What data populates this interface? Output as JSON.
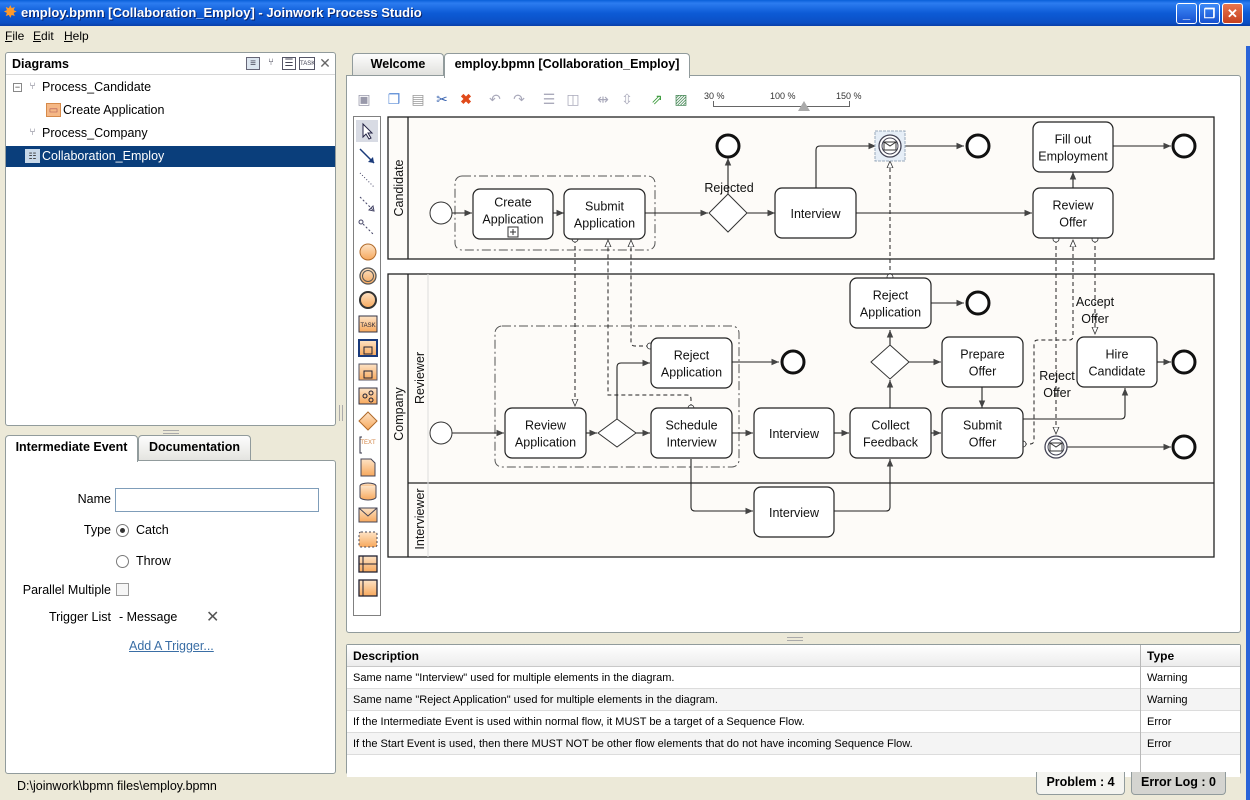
{
  "window": {
    "title": "employ.bpmn [Collaboration_Employ] - Joinwork Process Studio",
    "app_icon": "star-icon",
    "controls": [
      "minimize",
      "restore",
      "close"
    ]
  },
  "menu": [
    "File",
    "Edit",
    "Help"
  ],
  "diagrams_panel": {
    "title": "Diagrams",
    "header_icons": [
      "properties-icon",
      "process-icon",
      "collaboration-icon",
      "task-icon",
      "close-icon"
    ],
    "tree": [
      {
        "label": "Process_Candidate",
        "icon": "process-icon",
        "expanded": true,
        "level": 0
      },
      {
        "label": "Create Application",
        "icon": "subprocess-icon",
        "level": 1
      },
      {
        "label": "Process_Company",
        "icon": "process-warning-icon",
        "level": 0
      },
      {
        "label": "Collaboration_Employ",
        "icon": "collaboration-warning-icon",
        "level": 0,
        "selected": true
      }
    ]
  },
  "properties_panel": {
    "tabs": [
      "Intermediate Event",
      "Documentation"
    ],
    "active_tab": "Intermediate Event",
    "name_label": "Name",
    "name_value": "",
    "type_label": "Type",
    "type_options": [
      "Catch",
      "Throw"
    ],
    "type_selected": "Catch",
    "parallel_label": "Parallel Multiple",
    "parallel_checked": false,
    "trigger_label": "Trigger List",
    "trigger_value": "- Message",
    "add_trigger": "Add A Trigger..."
  },
  "editor": {
    "tabs": [
      "Welcome",
      "employ.bpmn [Collaboration_Employ]"
    ],
    "active_tab": "employ.bpmn [Collaboration_Employ]",
    "toolbar": [
      "save",
      "copy",
      "paste",
      "cut",
      "delete",
      "undo",
      "redo",
      "align-top",
      "align-middle",
      "distribute-h",
      "distribute-v",
      "export",
      "export-image"
    ],
    "zoom": {
      "labels": [
        "30 %",
        "100 %",
        "150 %"
      ],
      "value_percent": 110
    }
  },
  "palette": [
    "select",
    "sequence-flow",
    "association",
    "message-flow",
    "conditional-flow",
    "start-event",
    "intermediate-event",
    "end-event",
    "task",
    "subprocess-expanded",
    "subprocess",
    "call-activity",
    "gateway",
    "text-annotation",
    "data-object",
    "data-store",
    "message",
    "group",
    "lane-horizontal",
    "lane-vertical"
  ],
  "diagram": {
    "pools": [
      {
        "name": "Candidate",
        "lanes": []
      },
      {
        "name": "Company",
        "lanes": [
          "Reviewer",
          "Interviewer"
        ]
      }
    ],
    "tasks": {
      "create_application": [
        "Create",
        "Application"
      ],
      "submit_application": [
        "Submit",
        "Application"
      ],
      "interview_cand": [
        "Interview"
      ],
      "fill_out": [
        "Fill out",
        "Employment"
      ],
      "review_offer": [
        "Review",
        "Offer"
      ],
      "review_application": [
        "Review",
        "Application"
      ],
      "reject_application_1": [
        "Reject",
        "Application"
      ],
      "schedule_interview": [
        "Schedule",
        "Interview"
      ],
      "interview_rev": [
        "Interview"
      ],
      "reject_application_2": [
        "Reject",
        "Application"
      ],
      "collect_feedback": [
        "Collect",
        "Feedback"
      ],
      "prepare_offer": [
        "Prepare",
        "Offer"
      ],
      "submit_offer": [
        "Submit",
        "Offer"
      ],
      "hire_candidate": [
        "Hire",
        "Candidate"
      ],
      "interview_int": [
        "Interview"
      ]
    },
    "labels": {
      "rejected": "Rejected",
      "accept_offer": [
        "Accept",
        "Offer"
      ],
      "reject_offer": [
        "Reject",
        "Offer"
      ]
    }
  },
  "problems": {
    "columns": [
      "Description",
      "Type"
    ],
    "rows": [
      {
        "description": "Same name \"Interview\" used for multiple elements in the diagram.",
        "type": "Warning"
      },
      {
        "description": "Same name \"Reject Application\" used for multiple elements in the diagram.",
        "type": "Warning"
      },
      {
        "description": "If the Intermediate Event is used within normal flow, it MUST be a target of a Sequence Flow.",
        "type": "Error"
      },
      {
        "description": "If the Start Event is used, then there MUST NOT be other flow elements that do not have incoming Sequence Flow.",
        "type": "Error"
      }
    ],
    "tabs": [
      "Problem : 4",
      "Error Log : 0"
    ],
    "active_tab": "Problem : 4"
  },
  "status": {
    "path": "D:\\joinwork\\bpmn files\\employ.bpmn"
  }
}
